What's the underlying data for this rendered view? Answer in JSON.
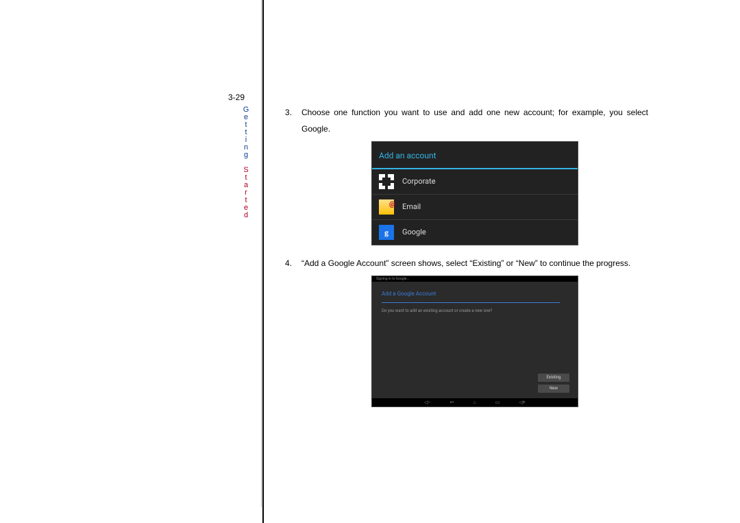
{
  "page_number": "3-29",
  "side_label": "Getting Started",
  "steps": [
    {
      "n": 3,
      "text": "Choose one function you want to use and add one new account; for example, you select Google."
    },
    {
      "n": 4,
      "text": "“Add a Google Account” screen shows, select “Existing” or “New” to continue the progress."
    }
  ],
  "shot1": {
    "header": "Add an account",
    "rows": [
      {
        "label": "Corporate",
        "icon": "corporate-icon"
      },
      {
        "label": "Email",
        "icon": "email-icon"
      },
      {
        "label": "Google",
        "icon": "google-icon"
      }
    ],
    "google_glyph": "g"
  },
  "shot2": {
    "topbar": "Signing in to Google...",
    "title": "Add a Google Account",
    "ask": "Do you want to add an existing account or create a new one?",
    "buttons": {
      "existing": "Existing",
      "new": "New"
    },
    "nav_icons": [
      "vol-down-icon",
      "back-icon",
      "home-icon",
      "recent-icon",
      "vol-up-icon"
    ],
    "nav_glyphs": [
      "◁−",
      "↩",
      "⌂",
      "▭",
      "◁+"
    ]
  }
}
